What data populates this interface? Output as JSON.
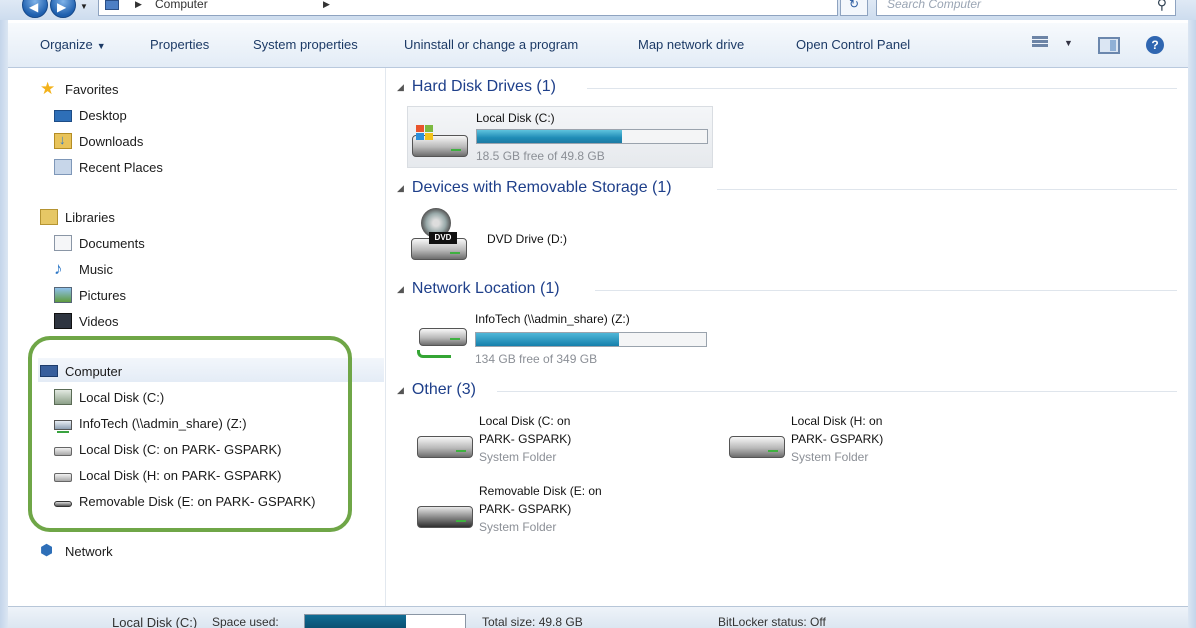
{
  "address": {
    "path_root": "Computer",
    "search_placeholder": "Search Computer"
  },
  "toolbar": {
    "organize": "Organize",
    "properties": "Properties",
    "system_properties": "System properties",
    "uninstall": "Uninstall or change a program",
    "map_drive": "Map network drive",
    "control_panel": "Open Control Panel"
  },
  "nav": {
    "favorites": "Favorites",
    "desktop": "Desktop",
    "downloads": "Downloads",
    "recent": "Recent Places",
    "libraries": "Libraries",
    "documents": "Documents",
    "music": "Music",
    "pictures": "Pictures",
    "videos": "Videos",
    "computer": "Computer",
    "computer_items": [
      "Local Disk (C:)",
      "InfoTech (\\\\admin_share) (Z:)",
      "Local Disk (C: on PARK- GSPARK)",
      "Local Disk (H: on PARK- GSPARK)",
      "Removable Disk (E: on PARK- GSPARK)"
    ],
    "network": "Network"
  },
  "groups": {
    "hdd": "Hard Disk Drives (1)",
    "removable": "Devices with Removable Storage (1)",
    "netloc": "Network Location (1)",
    "other": "Other (3)"
  },
  "drives": {
    "c": {
      "name": "Local Disk (C:)",
      "free": "18.5 GB free of 49.8 GB",
      "used_fraction": 0.63
    },
    "dvd": {
      "name": "DVD Drive (D:)",
      "label": "DVD"
    },
    "z": {
      "name": "InfoTech (\\\\admin_share) (Z:)",
      "free": "134 GB free of 349 GB",
      "used_fraction": 0.62
    },
    "other": [
      {
        "line1": "Local Disk (C: on",
        "line2": "PARK- GSPARK)",
        "sub": "System Folder"
      },
      {
        "line1": "Local Disk (H: on",
        "line2": "PARK- GSPARK)",
        "sub": "System Folder"
      },
      {
        "line1": "Removable Disk (E: on",
        "line2": "PARK- GSPARK)",
        "sub": "System Folder"
      }
    ]
  },
  "details": {
    "name": "Local Disk (C:)",
    "space_used_label": "Space used:",
    "used_fraction": 0.63,
    "total_size": "Total size: 49.8 GB",
    "bitlocker": "BitLocker status: Off"
  },
  "colors": {
    "highlight_ring": "#6fa647",
    "group_header": "#1e3f8a",
    "capacity_bar": "#1f8cb6"
  }
}
